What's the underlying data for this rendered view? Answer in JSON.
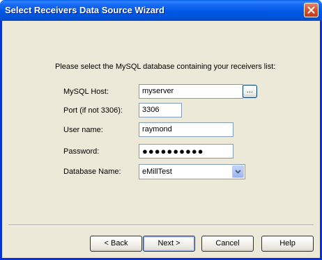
{
  "window": {
    "title": "Select Receivers Data Source Wizard"
  },
  "prompt": "Please select the MySQL database containing your receivers list:",
  "form": {
    "host_label": "MySQL Host:",
    "host_value": "myserver",
    "browse_label": "...",
    "port_label": "Port (if not 3306):",
    "port_value": "3306",
    "user_label": "User name:",
    "user_value": "raymond",
    "password_label": "Password:",
    "password_value": "●●●●●●●●●●",
    "database_label": "Database Name:",
    "database_value": "eMillTest"
  },
  "buttons": {
    "back": "< Back",
    "next": "Next >",
    "cancel": "Cancel",
    "help": "Help"
  },
  "icons": {
    "close": "close-icon",
    "dropdown": "chevron-down-icon"
  },
  "colors": {
    "titlebar": "#0058e6",
    "dialog_bg": "#ece9d8",
    "close": "#d9542f"
  }
}
